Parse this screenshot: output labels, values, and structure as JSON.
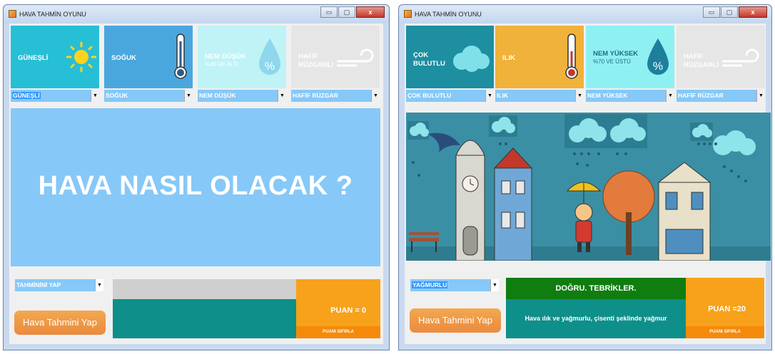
{
  "windows": [
    {
      "title": "HAVA TAHMİN OYUNU",
      "controls": {
        "minimize": "▭",
        "maximize": "▢",
        "close": "x"
      },
      "tiles": [
        {
          "label": "GÜNEŞLİ",
          "sub": "",
          "icon": "sun-icon",
          "color": "#26bfd6"
        },
        {
          "label": "SOĞUK",
          "sub": "",
          "icon": "thermometer-icon",
          "color": "#4aa7de"
        },
        {
          "label": "NEM DÜŞÜK",
          "sub": "%40 VE ALTI",
          "icon": "humidity-drop-icon",
          "color": "#bff3f6"
        },
        {
          "label": "HAFİF RÜZGARLI",
          "sub": "",
          "icon": "wind-icon",
          "color": "#e6e6e6"
        }
      ],
      "dropdowns": [
        "GÜNEŞLİ",
        "SOĞUK",
        "NEM DÜŞÜK",
        "HAFİF RÜZGAR"
      ],
      "main_text": "HAVA NASIL OLACAK ?",
      "guess_dropdown": "TAHMİNİNİ YAP",
      "predict_button": "Hava Tahmini Yap",
      "feedback_title": "",
      "feedback_body": "",
      "score": "PUAN = 0",
      "reset_button": "PUANI SIFIRLA"
    },
    {
      "title": "HAVA TAHMİN OYUNU",
      "controls": {
        "minimize": "▭",
        "maximize": "▢",
        "close": "x"
      },
      "tiles": [
        {
          "label": "ÇOK BULUTLU",
          "sub": "",
          "icon": "cloud-icon",
          "color": "#1e8ea1"
        },
        {
          "label": "ILIK",
          "sub": "",
          "icon": "thermometer-icon",
          "color": "#f0b23a"
        },
        {
          "label": "NEM YÜKSEK",
          "sub": "%70 VE ÜSTÜ",
          "icon": "humidity-drop-icon",
          "color": "#8ff0f2"
        },
        {
          "label": "HAFİF RÜZGARLI",
          "sub": "",
          "icon": "wind-icon",
          "color": "#e6e6e6"
        }
      ],
      "dropdowns": [
        "ÇOK BULUTLU",
        "ILIK",
        "NEM YÜKSEK",
        "HAFİF RÜZGAR"
      ],
      "guess_dropdown": "YAĞMURLU",
      "predict_button": "Hava Tahmini Yap",
      "feedback_title": "DOĞRU. TEBRİKLER.",
      "feedback_body": "Hava ılık ve yağmurlu, çisenti şeklinde yağmur",
      "score": "PUAN =20",
      "reset_button": "PUANI SIFIRLA"
    }
  ],
  "colors": {
    "panel_blue": "#86c8f8",
    "teal": "#0e8f8a",
    "feedback_green": "#0f7d10",
    "score_orange": "#f7a21a",
    "button_orange": "#eb8a3e"
  }
}
